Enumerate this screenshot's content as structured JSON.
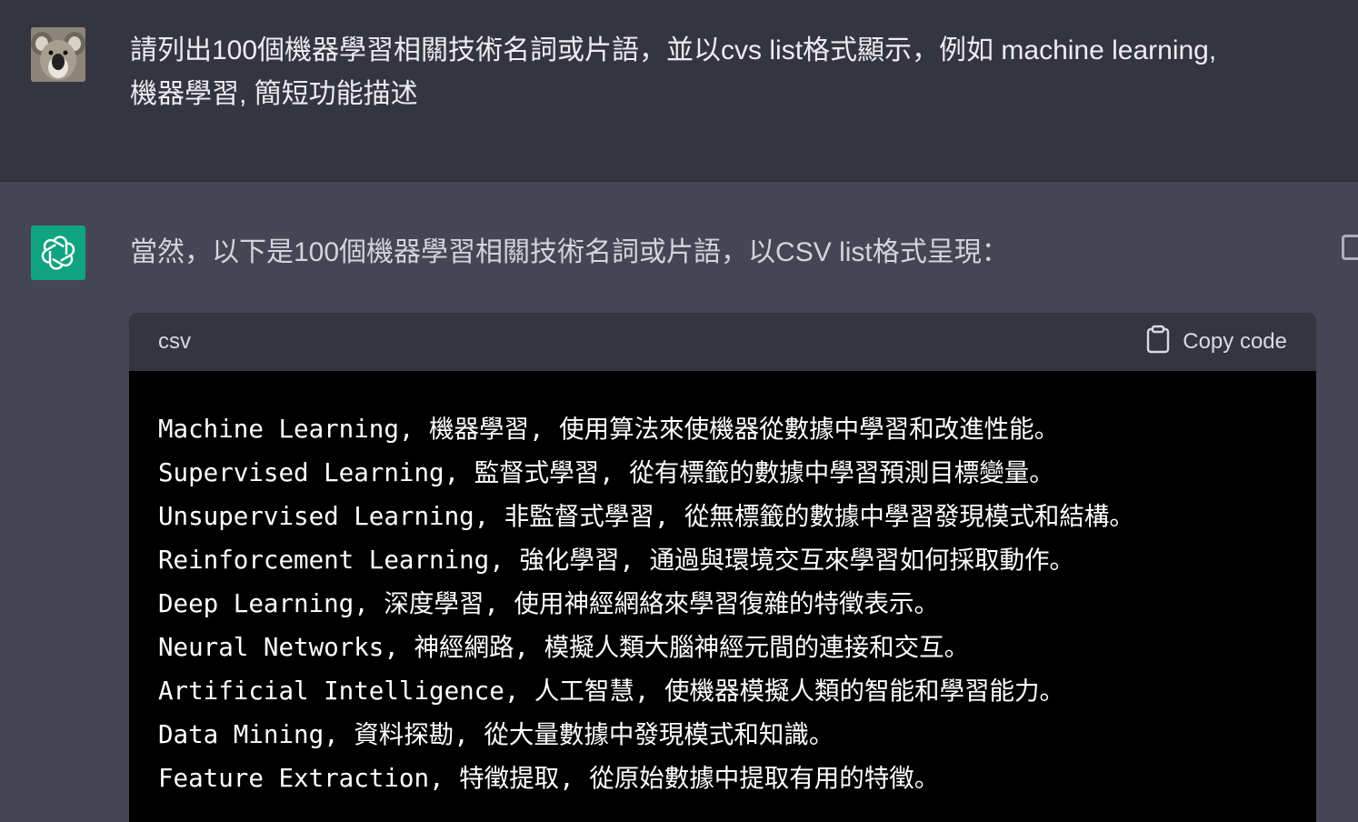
{
  "user": {
    "avatar_icon": "koala-avatar-icon",
    "message_line1": "請列出100個機器學習相關技術名詞或片語，並以cvs list格式顯示，例如 machine learning,",
    "message_line2": "機器學習, 簡短功能描述"
  },
  "assistant": {
    "logo_icon": "openai-logo-icon",
    "intro": "當然，以下是100個機器學習相關技術名詞或片語，以CSV list格式呈現：",
    "code_block": {
      "language": "csv",
      "copy_label": "Copy code",
      "lines": [
        "Machine Learning, 機器學習, 使用算法來使機器從數據中學習和改進性能。",
        "Supervised Learning, 監督式學習, 從有標籤的數據中學習預測目標變量。",
        "Unsupervised Learning, 非監督式學習, 從無標籤的數據中學習發現模式和結構。",
        "Reinforcement Learning, 強化學習, 通過與環境交互來學習如何採取動作。",
        "Deep Learning, 深度學習, 使用神經網絡來學習復雜的特徵表示。",
        "Neural Networks, 神經網路, 模擬人類大腦神經元間的連接和交互。",
        "Artificial Intelligence, 人工智慧, 使機器模擬人類的智能和學習能力。",
        "Data Mining, 資料探勘, 從大量數據中發現模式和知識。",
        "Feature Extraction, 特徵提取, 從原始數據中提取有用的特徵。"
      ]
    }
  },
  "colors": {
    "user_bg": "#343541",
    "assistant_bg": "#444654",
    "logo_green": "#10a37f",
    "code_bg": "#000000"
  }
}
